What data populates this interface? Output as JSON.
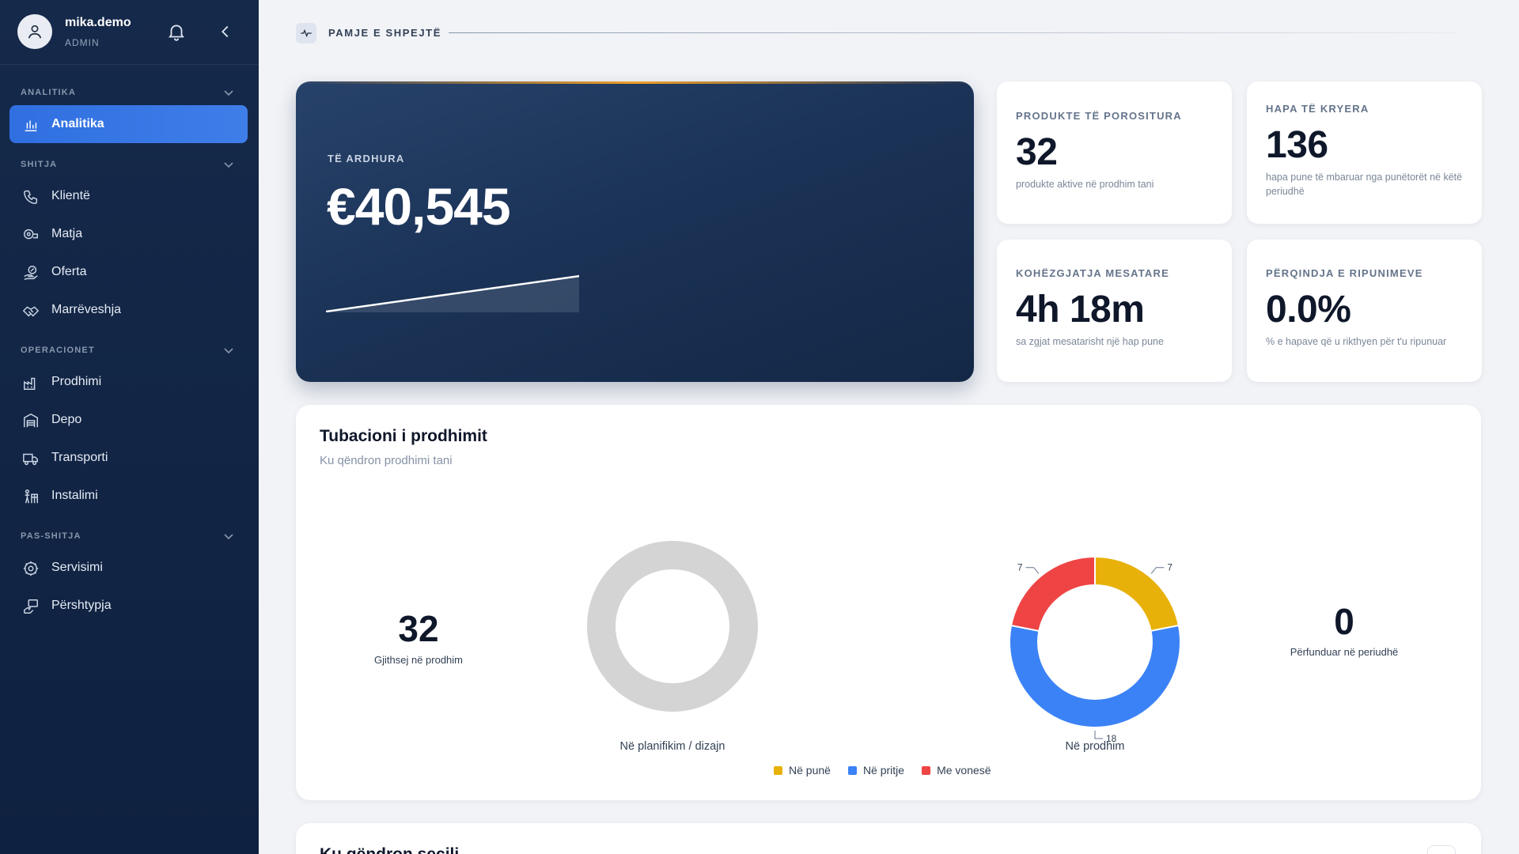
{
  "user": {
    "name": "mika.demo",
    "role": "ADMIN"
  },
  "sidebar": {
    "sections": [
      {
        "label": "ANALITIKA",
        "items": [
          {
            "label": "Analitika",
            "icon": "bar-chart-icon",
            "active": true
          }
        ]
      },
      {
        "label": "SHITJA",
        "items": [
          {
            "label": "Klientë",
            "icon": "phone-icon"
          },
          {
            "label": "Matja",
            "icon": "measure-tape-icon"
          },
          {
            "label": "Oferta",
            "icon": "offer-hand-icon"
          },
          {
            "label": "Marrëveshja",
            "icon": "handshake-icon"
          }
        ]
      },
      {
        "label": "OPERACIONET",
        "items": [
          {
            "label": "Prodhimi",
            "icon": "factory-icon"
          },
          {
            "label": "Depo",
            "icon": "warehouse-icon"
          },
          {
            "label": "Transporti",
            "icon": "truck-icon"
          },
          {
            "label": "Instalimi",
            "icon": "install-icon"
          }
        ]
      },
      {
        "label": "PAS-SHITJA",
        "items": [
          {
            "label": "Servisimi",
            "icon": "service-gear-icon"
          },
          {
            "label": "Përshtypja",
            "icon": "feedback-icon"
          }
        ]
      }
    ]
  },
  "quick_view": {
    "title": "PAMJE E SHPEJTË"
  },
  "revenue": {
    "label": "TË ARDHURA",
    "value": "€40,545"
  },
  "kpis": [
    {
      "label": "PRODUKTE TË POROSITURA",
      "value": "32",
      "desc": "produkte aktive në prodhim tani"
    },
    {
      "label": "HAPA TË KRYERA",
      "value": "136",
      "desc": "hapa pune të mbaruar nga punëtorët në këtë periudhë"
    },
    {
      "label": "KOHËZGJATJA MESATARE",
      "value": "4h 18m",
      "desc": "sa zgjat mesatarisht një hap pune"
    },
    {
      "label": "PËRQINDJA E RIPUNIMEVE",
      "value": "0.0%",
      "desc": "% e hapave që u rikthyen për t'u ripunuar"
    }
  ],
  "pipeline": {
    "title": "Tubacioni i prodhimit",
    "subtitle": "Ku qëndron prodhimi tani",
    "total_value": "32",
    "total_label": "Gjithsej në prodhim",
    "done_value": "0",
    "done_label": "Përfunduar në periudhë",
    "legend": [
      {
        "name": "Në punë",
        "color": "#e8b10a"
      },
      {
        "name": "Në pritje",
        "color": "#3b82f6"
      },
      {
        "name": "Me vonesë",
        "color": "#ef4444"
      }
    ]
  },
  "chart_data": [
    {
      "type": "pie",
      "title": "Në planifikim / dizajn",
      "series": [
        {
          "values": [
            0,
            0,
            0
          ]
        }
      ]
    },
    {
      "type": "pie",
      "title": "Në prodhim",
      "categories": [
        "Në punë",
        "Në pritje",
        "Me vonesë"
      ],
      "values": [
        7,
        18,
        7
      ],
      "colors": [
        "#e8b10a",
        "#3b82f6",
        "#ef4444"
      ]
    }
  ],
  "next_section": {
    "title": "Ku qëndron secili"
  }
}
